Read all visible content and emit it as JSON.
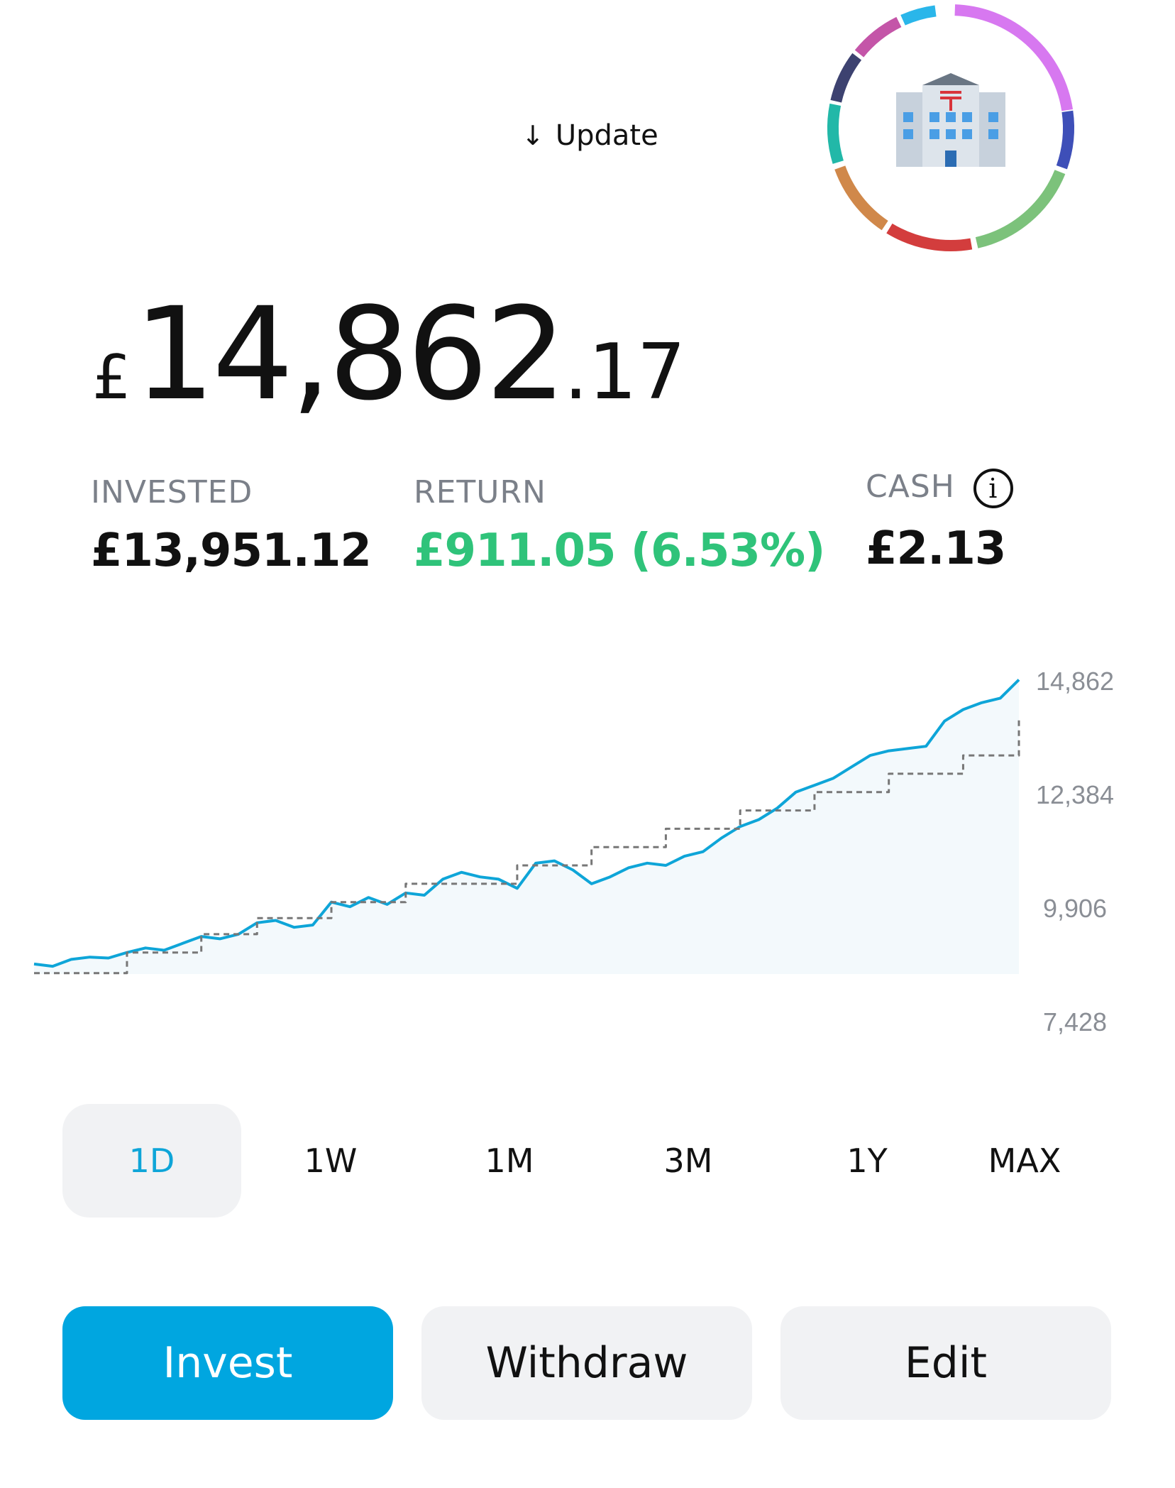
{
  "update": {
    "label": "Update",
    "icon": "arrow-down-icon"
  },
  "avatar": {
    "icon": "office-building-icon"
  },
  "balance": {
    "currency": "£",
    "integer": "14,862",
    "decimal": ".17"
  },
  "stats": {
    "invested": {
      "label": "INVESTED",
      "value": "£13,951.12"
    },
    "return": {
      "label": "RETURN",
      "value": "£911.05 (6.53%)",
      "color": "#2fc37a"
    },
    "cash": {
      "label": "CASH",
      "value": "£2.13",
      "info_icon": "info-icon"
    }
  },
  "chart_data": {
    "type": "line",
    "y_ticks": [
      "14,862",
      "12,384",
      "9,906",
      "7,428"
    ],
    "ylim": [
      7428,
      14862
    ],
    "series": [
      {
        "style": "solid",
        "color": "#0ea5d8",
        "values": [
          8700,
          8650,
          8800,
          8850,
          8830,
          8950,
          9050,
          9000,
          9150,
          9300,
          9250,
          9350,
          9600,
          9650,
          9500,
          9550,
          10050,
          9950,
          10150,
          10000,
          10250,
          10200,
          10550,
          10700,
          10600,
          10550,
          10350,
          10900,
          10950,
          10750,
          10450,
          10600,
          10800,
          10900,
          10850,
          11050,
          11150,
          11450,
          11700,
          11850,
          12100,
          12450,
          12600,
          12750,
          13000,
          13250,
          13350,
          13400,
          13450,
          14000,
          14250,
          14400,
          14500,
          14900
        ]
      },
      {
        "style": "dashed",
        "color": "#777777",
        "values": [
          8500,
          8500,
          8500,
          8500,
          8500,
          8950,
          8950,
          8950,
          8950,
          9350,
          9350,
          9350,
          9700,
          9700,
          9700,
          9700,
          10050,
          10050,
          10050,
          10050,
          10450,
          10450,
          10450,
          10450,
          10450,
          10450,
          10850,
          10850,
          10850,
          10850,
          11250,
          11250,
          11250,
          11250,
          11650,
          11650,
          11650,
          11650,
          12050,
          12050,
          12050,
          12050,
          12450,
          12450,
          12450,
          12450,
          12850,
          12850,
          12850,
          12850,
          13250,
          13250,
          13250,
          14100
        ]
      }
    ]
  },
  "ranges": [
    "1D",
    "1W",
    "1M",
    "3M",
    "1Y",
    "MAX"
  ],
  "active_range": "1D",
  "actions": {
    "invest": "Invest",
    "withdraw": "Withdraw",
    "edit": "Edit"
  },
  "colors": {
    "accent": "#00a6e0",
    "positive": "#2fc37a"
  }
}
